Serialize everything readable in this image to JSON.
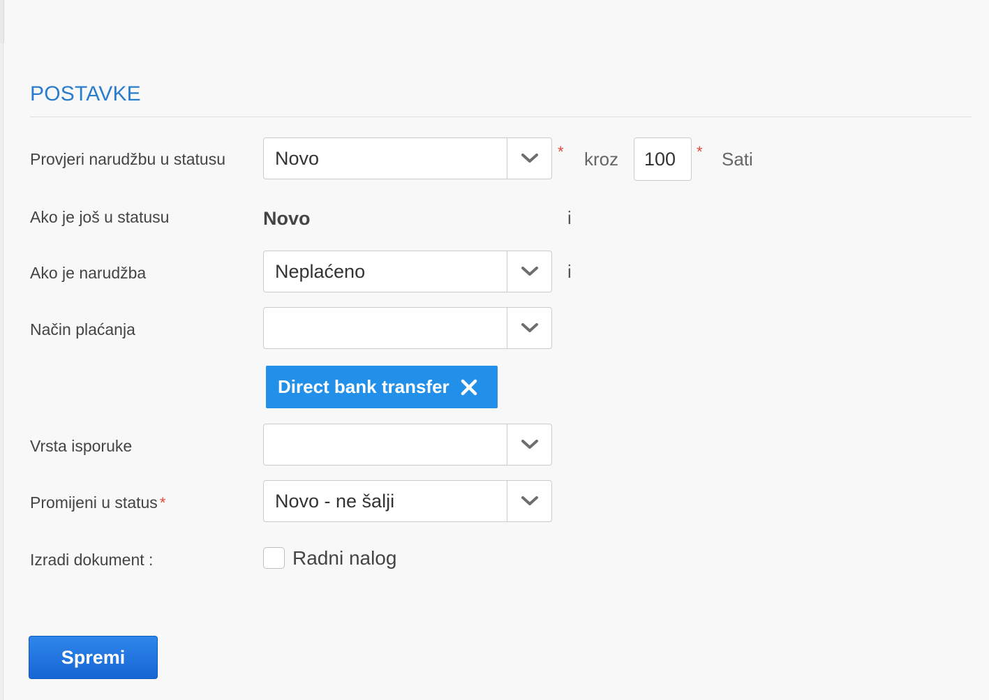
{
  "section": {
    "title": "POSTAVKE"
  },
  "rows": {
    "check_status": {
      "label": "Provjeri narudžbu u statusu",
      "value": "Novo",
      "star": "*",
      "through_label": "kroz",
      "hours_value": "100",
      "hours_star": "*",
      "hours_unit": "Sati"
    },
    "still_status": {
      "label": "Ako je još u statusu",
      "value": "Novo",
      "info_glyph": "i"
    },
    "order_is": {
      "label": "Ako je narudžba",
      "value": "Neplaćeno",
      "info_glyph": "i"
    },
    "payment_method": {
      "label": "Način plaćanja",
      "value": "",
      "selected_tags": [
        "Direct bank transfer"
      ]
    },
    "delivery_type": {
      "label": "Vrsta isporuke",
      "value": ""
    },
    "change_status": {
      "label": "Promijeni u status",
      "required_star": "*",
      "value": "Novo - ne šalji"
    },
    "create_document": {
      "label": "Izradi dokument :",
      "checkbox_label": "Radni nalog",
      "checked": false
    }
  },
  "actions": {
    "save_label": "Spremi"
  },
  "icons": {
    "select_arrow": "chevron-down-icon",
    "tag_remove": "close-icon"
  },
  "colors": {
    "accent_title": "#2a7ccc",
    "tag_background": "#2290e8",
    "button_background": "#1a6fdc",
    "required_star": "#e04a3b"
  }
}
